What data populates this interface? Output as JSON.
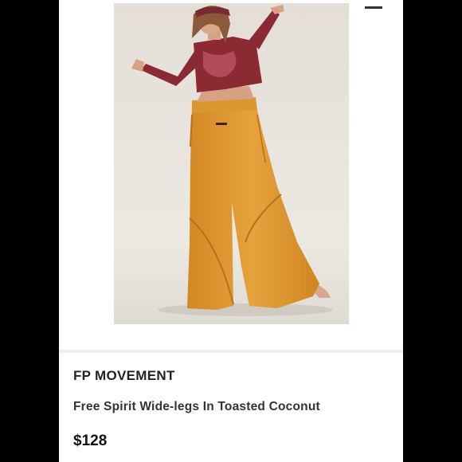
{
  "product": {
    "brand": "FP MOVEMENT",
    "title": "Free Spirit Wide-legs In Toasted Coconut",
    "price": "$128"
  },
  "colors": {
    "background": "#000000",
    "card": "#ffffff",
    "pants": "#e09a34",
    "top": "#8c2a33",
    "backdrop": "#ece9e3"
  },
  "icons": {
    "corner": "dash-icon"
  }
}
